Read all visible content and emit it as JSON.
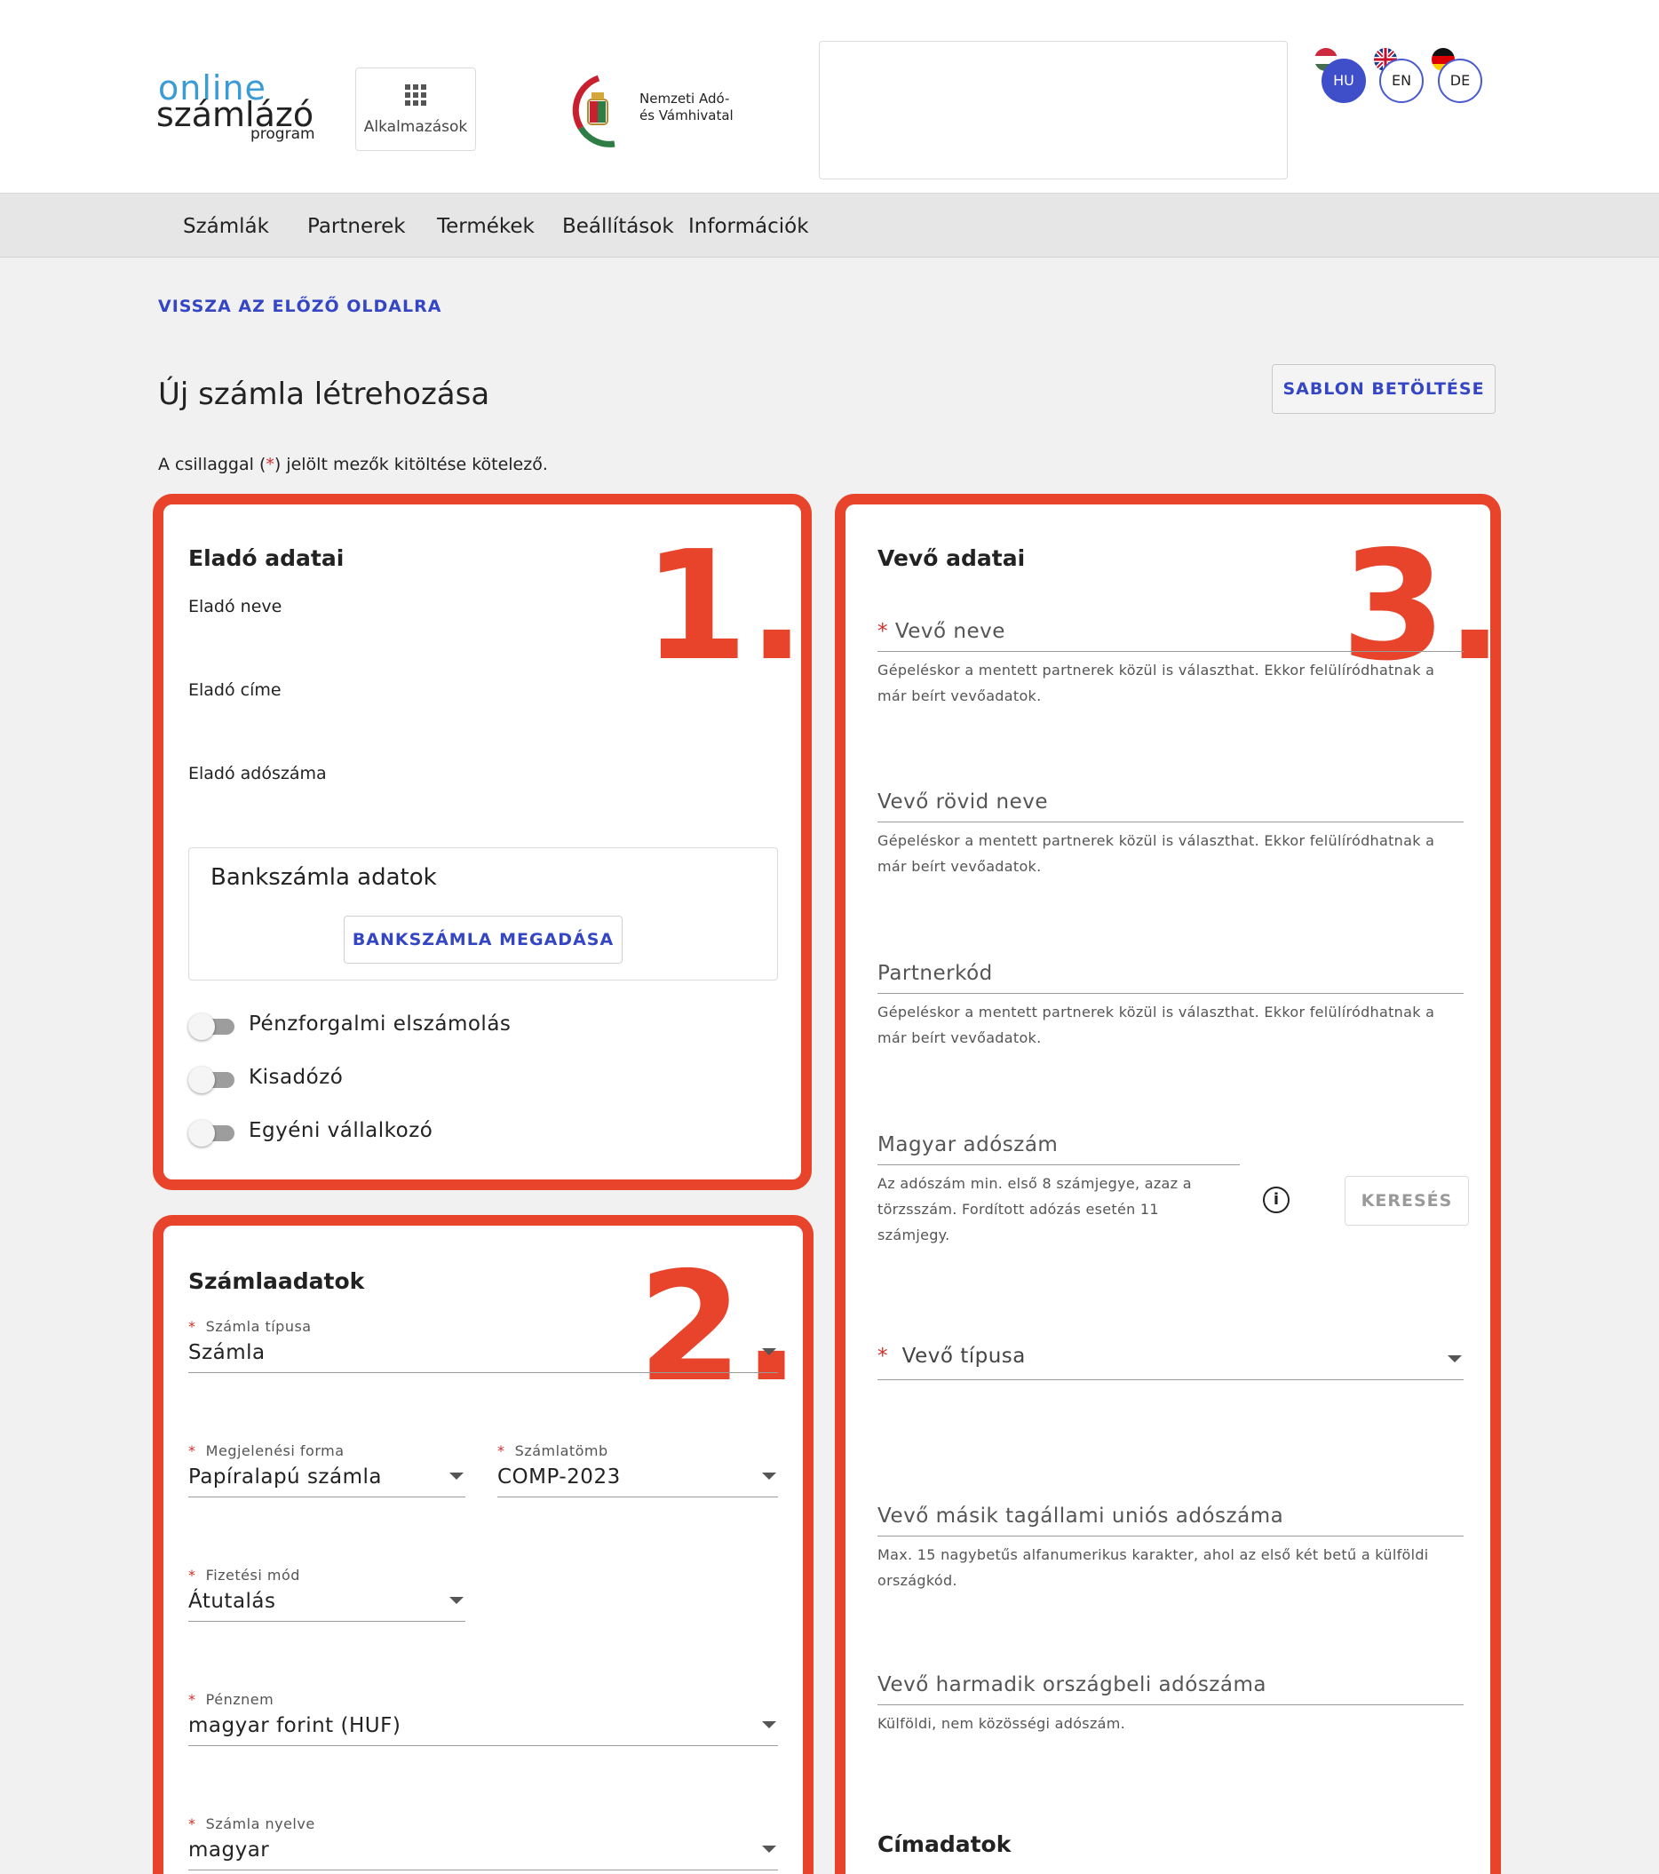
{
  "header": {
    "logo": {
      "line1": "online",
      "line2": "számlázó",
      "line3": "program"
    },
    "apps_label": "Alkalmazások",
    "nav_logo": {
      "line1": "Nemzeti Adó-",
      "line2": "és Vámhivatal"
    },
    "languages": [
      {
        "code": "HU",
        "active": true
      },
      {
        "code": "EN",
        "active": false
      },
      {
        "code": "DE",
        "active": false
      }
    ]
  },
  "navbar": [
    "Számlák",
    "Partnerek",
    "Termékek",
    "Beállítások",
    "Információk"
  ],
  "back_link": "VISSZA AZ ELŐZŐ OLDALRA",
  "page_title": "Új számla létrehozása",
  "template_button": "SABLON BETÖLTÉSE",
  "required_note": {
    "before": "A csillaggal (",
    "ast": "*",
    "after": ") jelölt mezők kitöltése kötelező."
  },
  "seller": {
    "title": "Eladó adatai",
    "name_label": "Eladó neve",
    "address_label": "Eladó címe",
    "tax_label": "Eladó adószáma",
    "bank_title": "Bankszámla adatok",
    "bank_button": "BANKSZÁMLA MEGADÁSA",
    "toggles": [
      {
        "label": "Pénzforgalmi elszámolás",
        "on": false
      },
      {
        "label": "Kisadózó",
        "on": false
      },
      {
        "label": "Egyéni vállalkozó",
        "on": false
      }
    ]
  },
  "invoice": {
    "title": "Számlaadatok",
    "type": {
      "label": "Számla típusa",
      "value": "Számla"
    },
    "format": {
      "label": "Megjelenési forma",
      "value": "Papíralapú számla"
    },
    "block": {
      "label": "Számlatömb",
      "value": "COMP-2023"
    },
    "payment": {
      "label": "Fizetési mód",
      "value": "Átutalás"
    },
    "currency": {
      "label": "Pénznem",
      "value": "magyar forint (HUF)"
    },
    "language": {
      "label": "Számla nyelve",
      "value": "magyar"
    }
  },
  "buyer": {
    "title": "Vevő adatai",
    "name_label": "Vevő neve",
    "name_hint_1": "Gépeléskor a mentett partnerek közül is választhat. Ekkor felülíródhatnak a",
    "name_hint_2": "már beírt vevőadatok.",
    "short_label": "Vevő rövid neve",
    "short_hint_1": "Gépeléskor a mentett partnerek közül is választhat. Ekkor felülíródhatnak a",
    "short_hint_2": "már beírt vevőadatok.",
    "code_label": "Partnerkód",
    "code_hint_1": "Gépeléskor a mentett partnerek közül is választhat. Ekkor felülíródhatnak a",
    "code_hint_2": "már beírt vevőadatok.",
    "tax_label": "Magyar adószám",
    "tax_hint_1": "Az adószám min. első 8 számjegye, azaz a",
    "tax_hint_2": "törzsszám. Fordított adózás esetén 11",
    "tax_hint_3": "számjegy.",
    "search_button": "KERESÉS",
    "type_label": "Vevő típusa",
    "eu_label": "Vevő másik tagállami uniós adószáma",
    "eu_hint_1": "Max. 15 nagybetűs alfanumerikus karakter, ahol az első két betű a külföldi",
    "eu_hint_2": "országkód.",
    "third_label": "Vevő harmadik országbeli adószáma",
    "third_hint": "Külföldi, nem közösségi adószám.",
    "address_title": "Címadatok"
  },
  "annotations": [
    "1.",
    "2.",
    "3."
  ],
  "colors": {
    "annotation": "#e8432b",
    "accent": "#3446c4",
    "required": "#d2302a"
  }
}
